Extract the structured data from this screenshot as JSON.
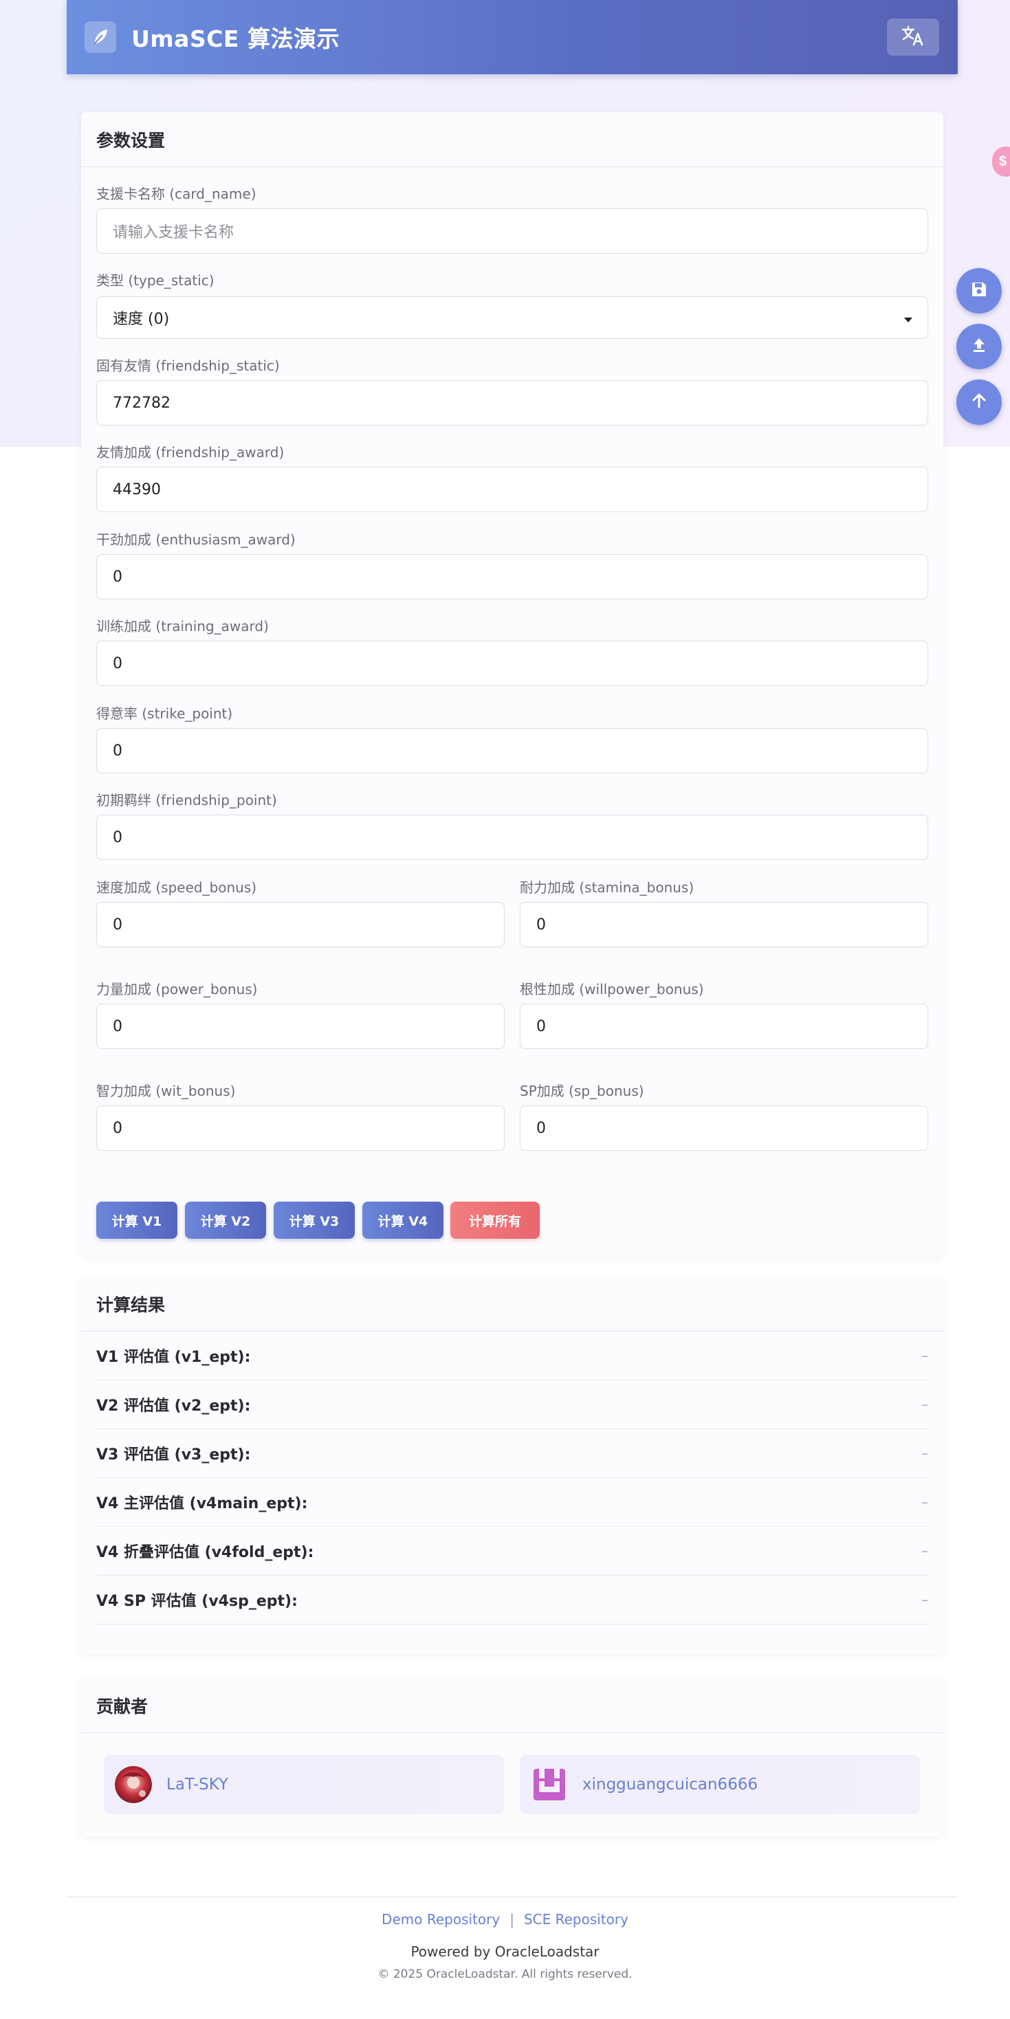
{
  "header": {
    "title": "UmaSCE 算法演示",
    "logo_icon": "feather-pen-icon",
    "lang_icon": "translate-icon"
  },
  "params": {
    "title": "参数设置",
    "card_name": {
      "label": "支援卡名称 (card_name)",
      "placeholder": "请输入支援卡名称"
    },
    "type_static": {
      "label": "类型 (type_static)",
      "value": "速度 (0)"
    },
    "friendship_static": {
      "label": "固有友情 (friendship_static)",
      "value": "772782"
    },
    "friendship_award": {
      "label": "友情加成 (friendship_award)",
      "value": "44390"
    },
    "enthusiasm_award": {
      "label": "干劲加成 (enthusiasm_award)",
      "value": "0"
    },
    "training_award": {
      "label": "训练加成 (training_award)",
      "value": "0"
    },
    "strike_point": {
      "label": "得意率 (strike_point)",
      "value": "0"
    },
    "friendship_point": {
      "label": "初期羁绊 (friendship_point)",
      "value": "0"
    },
    "speed_bonus": {
      "label": "速度加成 (speed_bonus)",
      "value": "0"
    },
    "stamina_bonus": {
      "label": "耐力加成 (stamina_bonus)",
      "value": "0"
    },
    "power_bonus": {
      "label": "力量加成 (power_bonus)",
      "value": "0"
    },
    "willpower_bonus": {
      "label": "根性加成 (willpower_bonus)",
      "value": "0"
    },
    "wit_bonus": {
      "label": "智力加成 (wit_bonus)",
      "value": "0"
    },
    "sp_bonus": {
      "label": "SP加成 (sp_bonus)",
      "value": "0"
    }
  },
  "buttons": {
    "v1": "计算 V1",
    "v2": "计算 V2",
    "v3": "计算 V3",
    "v4": "计算 V4",
    "all": "计算所有"
  },
  "results": {
    "title": "计算结果",
    "rows": [
      {
        "label": "V1 评估值 (v1_ept):",
        "value": "–"
      },
      {
        "label": "V2 评估值 (v2_ept):",
        "value": "–"
      },
      {
        "label": "V3 评估值 (v3_ept):",
        "value": "–"
      },
      {
        "label": "V4 主评估值 (v4main_ept):",
        "value": "–"
      },
      {
        "label": "V4 折叠评估值 (v4fold_ept):",
        "value": "–"
      },
      {
        "label": "V4 SP 评估值 (v4sp_ept):",
        "value": "–"
      }
    ]
  },
  "contributors": {
    "title": "贡献者",
    "items": [
      {
        "name": "LaT-SKY"
      },
      {
        "name": "xingguangcuican6666"
      }
    ]
  },
  "footer": {
    "demo_repo": "Demo Repository",
    "separator": "|",
    "sce_repo": "SCE Repository",
    "powered": "Powered by OracleLoadstar",
    "copyright": "© 2025 OracleLoadstar. All rights reserved."
  },
  "fabs": [
    "save-icon",
    "upload-icon",
    "arrow-up-icon"
  ],
  "colors": {
    "accent": "#6d8fe0",
    "danger": "#e9666c",
    "link": "#6780d4"
  }
}
